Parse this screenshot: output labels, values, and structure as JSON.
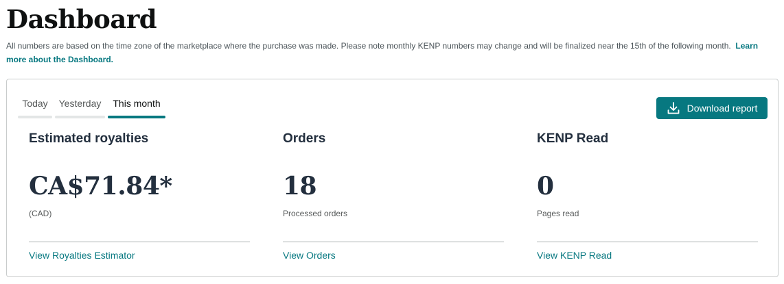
{
  "page": {
    "title": "Dashboard",
    "intro_text": "All numbers are based on the time zone of the marketplace where the purchase was made. Please note monthly KENP numbers may change and will be finalized near the 15th of the following month.",
    "learn_more_link": "Learn more about the Dashboard."
  },
  "tabs": [
    {
      "label": "Today",
      "active": false
    },
    {
      "label": "Yesterday",
      "active": false
    },
    {
      "label": "This month",
      "active": true
    }
  ],
  "download_button": {
    "label": "Download report",
    "icon": "download-icon"
  },
  "metrics": [
    {
      "heading": "Estimated royalties",
      "value": "CA$71.84*",
      "subtext": "(CAD)",
      "link": "View Royalties Estimator"
    },
    {
      "heading": "Orders",
      "value": "18",
      "subtext": "Processed orders",
      "link": "View Orders"
    },
    {
      "heading": "KENP Read",
      "value": "0",
      "subtext": "Pages read",
      "link": "View KENP Read"
    }
  ],
  "colors": {
    "accent": "#077880",
    "heading_text": "#232f3e",
    "muted_text": "#565959",
    "border": "#c9cccc"
  }
}
